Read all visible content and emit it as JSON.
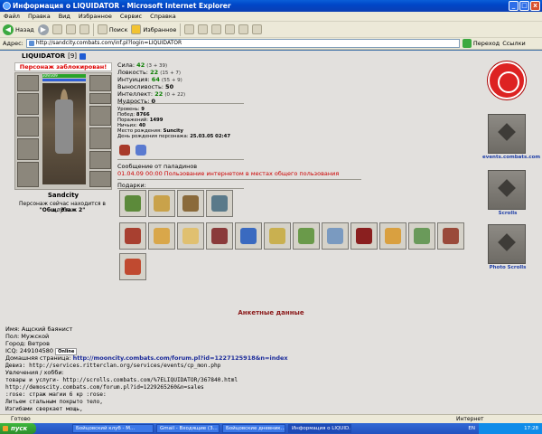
{
  "window": {
    "title": "Информация о LIQUIDATOR - Microsoft Internet Explorer",
    "buttons": [
      "_",
      "□",
      "x"
    ]
  },
  "menu": [
    "Файл",
    "Правка",
    "Вид",
    "Избранное",
    "Сервис",
    "Справка"
  ],
  "toolbar": {
    "back": "Назад",
    "search": "Поиск",
    "favorites": "Избранное"
  },
  "address": {
    "label": "Адрес:",
    "url": "http://sandcity.combats.com/inf.pl?login=LIQUIDATOR",
    "go": "Переход",
    "links": "Ссылки"
  },
  "character": {
    "name": "LIQUIDATOR",
    "level": "[9]",
    "blocked": "Персонаж заблокирован!",
    "hp": "309/309",
    "city": "Sandcity",
    "club_status": "Персонаж сейчас находится в клубе.",
    "room": "\"Общ. Этаж 2\""
  },
  "stats": [
    {
      "name": "Сила:",
      "value": "42",
      "bonus": "(3 + 39)",
      "color": "#0a7d00"
    },
    {
      "name": "Ловкость:",
      "value": "22",
      "bonus": "(15 + 7)",
      "color": "#0a7d00"
    },
    {
      "name": "Интуиция:",
      "value": "64",
      "bonus": "(55 + 9)",
      "color": "#0a7d00"
    },
    {
      "name": "Выносливость:",
      "value": "50",
      "bonus": "",
      "color": "#000000"
    },
    {
      "name": "Интеллект:",
      "value": "22",
      "bonus": "(0 + 22)",
      "color": "#0a7d00"
    },
    {
      "name": "Мудрость:",
      "value": "0",
      "bonus": "",
      "color": "#000000"
    }
  ],
  "details": [
    {
      "label": "Уровень:",
      "value": "9"
    },
    {
      "label": "Побед:",
      "value": "8766"
    },
    {
      "label": "Поражений:",
      "value": "1499"
    },
    {
      "label": "Ничьих:",
      "value": "40"
    },
    {
      "label": "Место рождения:",
      "value": "Suncity"
    },
    {
      "label": "День рождения персонажа:",
      "value": "25.03.05 02:47"
    }
  ],
  "message": {
    "header": "Сообщение от паладинов",
    "text": "01.04.09 00:00 Пользование интернетом в местах общего пользования"
  },
  "gifts": {
    "label": "Подарки:",
    "colors": [
      "#5c8a3a",
      "#c9a24a",
      "#8a6a3a",
      "#5a7a8a",
      "#a84030",
      "#d9a74a",
      "#e0c070",
      "#8a3a3a",
      "#3a6ac0",
      "#c9b050",
      "#6a9a4a",
      "#7a9ac0",
      "#8a1f1f",
      "#d9a040",
      "#6a9a5a",
      "#9a4a3a",
      "#c04a30"
    ]
  },
  "sidebar": [
    {
      "label": ""
    },
    {
      "label": "events.combats.com"
    },
    {
      "label": "Scrolls"
    },
    {
      "label": "Photo Scrolls"
    }
  ],
  "anket": {
    "title": "Анкетные данные",
    "name": "Имя: Ащский баянист",
    "sex": "Пол: Мужской",
    "city": "Город: Ветров",
    "icq": "ICQ: 249104580",
    "online": "Online",
    "homepage_label": "Домашняя страница:",
    "homepage": "http://mooncity.combats.com/forum.pl?id=1227125918&n=index",
    "motto": "Девиз: http://services.ritterclan.org/services/events/cp_mon.php",
    "hobby": "Увлечения / хобби:",
    "line1": "товары  и услуги-  http://scrolls.combats.com/%7ELIQUIDATOR/367840.html",
    "line2": "http://demoscity.combats.com/forum.pl?id=1229265260&n=sales",
    "line3": ":rose: страж магии 6 кр :rose:",
    "line4": "Литьем стальным покрыто тело,",
    "line5": "Изгибами сверкает мощь,"
  },
  "status": {
    "text": "Готово",
    "zone": "Интернет"
  },
  "taskbar": {
    "start": "пуск",
    "tasks": [
      "Бойцовский клуб - М...",
      "Gmail - Входящие (3...",
      "Бойцовские дневник...",
      "Информация о LIQUID..."
    ],
    "lang": "EN",
    "clock": "17:28"
  }
}
